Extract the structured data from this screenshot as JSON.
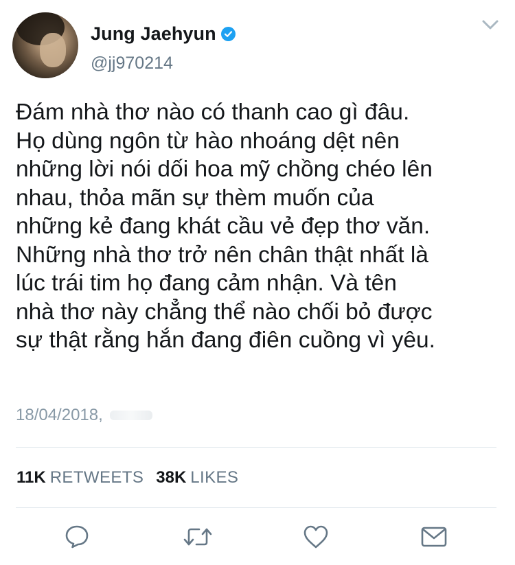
{
  "author": {
    "display_name": "Jung Jaehyun",
    "handle": "@jj970214",
    "verified": true
  },
  "tweet": {
    "text": "Đám nhà thơ nào có thanh cao gì đâu.\nHọ dùng ngôn từ hào nhoáng dệt nên\nnhững lời nói dối hoa mỹ chồng chéo lên\nnhau, thỏa mãn sự thèm muốn của\nnhững kẻ đang khát cầu vẻ đẹp thơ văn.\nNhững nhà thơ trở nên chân thật nhất là\nlúc trái tim họ đang cảm nhận. Và tên\nnhà thơ này chẳng thể nào chối bỏ được\nsự thật rằng hắn đang điên cuồng vì yêu.",
    "timestamp": "18/04/2018,"
  },
  "stats": {
    "retweets_count": "11K",
    "retweets_label": "RETWEETS",
    "likes_count": "38K",
    "likes_label": "LIKES"
  },
  "icons": {
    "menu": "chevron-down-icon",
    "verified": "verified-badge-icon",
    "reply": "reply-icon",
    "retweet": "retweet-icon",
    "like": "heart-icon",
    "message": "envelope-icon"
  },
  "colors": {
    "verified_blue": "#1da1f2",
    "secondary_text": "#657786",
    "icon_gray": "#657786",
    "divider": "#e1e8ed"
  }
}
